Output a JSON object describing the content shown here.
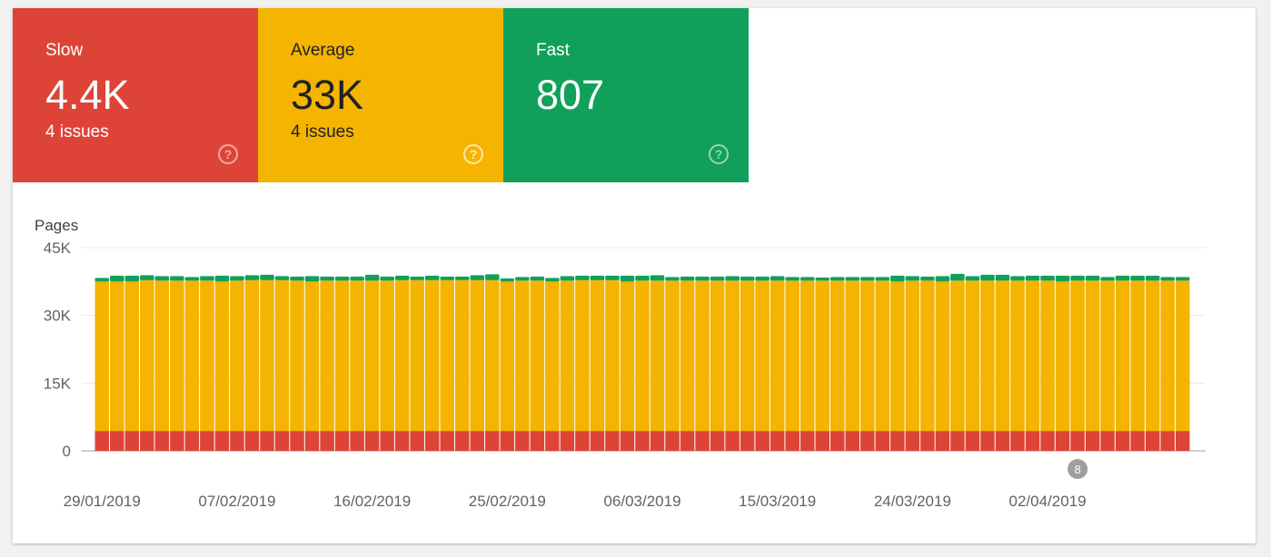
{
  "tiles": {
    "slow": {
      "label": "Slow",
      "value": "4.4K",
      "issues": "4 issues",
      "color": "#dd4437"
    },
    "average": {
      "label": "Average",
      "value": "33K",
      "issues": "4 issues",
      "color": "#f4b400"
    },
    "fast": {
      "label": "Fast",
      "value": "807",
      "issues": "",
      "color": "#11a05a"
    }
  },
  "help_icon": "question-circle-icon",
  "annotation": {
    "label": "8",
    "date": "04/04/2019",
    "color": "#9e9e9e"
  },
  "chart_data": {
    "type": "bar",
    "stacked": true,
    "ylabel": "Pages",
    "xlabel": "",
    "ylim": [
      0,
      45000
    ],
    "yticks": [
      0,
      15000,
      30000,
      45000
    ],
    "ytick_labels": [
      "0",
      "15K",
      "30K",
      "45K"
    ],
    "x_tick_labels": [
      {
        "label": "29/01/2019",
        "index": 0
      },
      {
        "label": "07/02/2019",
        "index": 9
      },
      {
        "label": "16/02/2019",
        "index": 18
      },
      {
        "label": "25/02/2019",
        "index": 27
      },
      {
        "label": "06/03/2019",
        "index": 36
      },
      {
        "label": "15/03/2019",
        "index": 45
      },
      {
        "label": "24/03/2019",
        "index": 54
      },
      {
        "label": "02/04/2019",
        "index": 63
      }
    ],
    "categories": [
      "29/01/2019",
      "30/01/2019",
      "31/01/2019",
      "01/02/2019",
      "02/02/2019",
      "03/02/2019",
      "04/02/2019",
      "05/02/2019",
      "06/02/2019",
      "07/02/2019",
      "08/02/2019",
      "09/02/2019",
      "10/02/2019",
      "11/02/2019",
      "12/02/2019",
      "13/02/2019",
      "14/02/2019",
      "15/02/2019",
      "16/02/2019",
      "17/02/2019",
      "18/02/2019",
      "19/02/2019",
      "20/02/2019",
      "21/02/2019",
      "22/02/2019",
      "23/02/2019",
      "24/02/2019",
      "25/02/2019",
      "26/02/2019",
      "27/02/2019",
      "28/02/2019",
      "01/03/2019",
      "02/03/2019",
      "03/03/2019",
      "04/03/2019",
      "05/03/2019",
      "06/03/2019",
      "07/03/2019",
      "08/03/2019",
      "09/03/2019",
      "10/03/2019",
      "11/03/2019",
      "12/03/2019",
      "13/03/2019",
      "14/03/2019",
      "15/03/2019",
      "16/03/2019",
      "17/03/2019",
      "18/03/2019",
      "19/03/2019",
      "20/03/2019",
      "21/03/2019",
      "22/03/2019",
      "23/03/2019",
      "24/03/2019",
      "25/03/2019",
      "26/03/2019",
      "27/03/2019",
      "28/03/2019",
      "29/03/2019",
      "30/03/2019",
      "31/03/2019",
      "01/04/2019",
      "02/04/2019",
      "03/04/2019",
      "04/04/2019",
      "05/04/2019",
      "06/04/2019",
      "07/04/2019",
      "08/04/2019",
      "09/04/2019",
      "10/04/2019",
      "11/04/2019"
    ],
    "series": [
      {
        "name": "Slow",
        "color": "#dd4437",
        "values": [
          4400,
          4400,
          4400,
          4400,
          4400,
          4400,
          4400,
          4400,
          4400,
          4400,
          4400,
          4400,
          4400,
          4400,
          4400,
          4400,
          4400,
          4400,
          4400,
          4400,
          4400,
          4400,
          4400,
          4400,
          4400,
          4400,
          4400,
          4400,
          4400,
          4400,
          4400,
          4400,
          4400,
          4400,
          4400,
          4400,
          4400,
          4400,
          4400,
          4400,
          4400,
          4400,
          4400,
          4400,
          4400,
          4400,
          4400,
          4400,
          4400,
          4400,
          4400,
          4400,
          4400,
          4400,
          4400,
          4400,
          4400,
          4400,
          4400,
          4400,
          4400,
          4400,
          4400,
          4400,
          4400,
          4400,
          4400,
          4400,
          4400,
          4400,
          4400,
          4400,
          4400
        ]
      },
      {
        "name": "Average",
        "color": "#f4b400",
        "values": [
          33100,
          33100,
          33100,
          33400,
          33300,
          33300,
          33300,
          33300,
          33100,
          33300,
          33400,
          33400,
          33400,
          33300,
          33100,
          33300,
          33300,
          33300,
          33300,
          33300,
          33400,
          33400,
          33400,
          33400,
          33400,
          33400,
          33400,
          33100,
          33300,
          33300,
          33100,
          33300,
          33400,
          33400,
          33400,
          33100,
          33300,
          33300,
          33300,
          33300,
          33300,
          33300,
          33300,
          33300,
          33300,
          33300,
          33300,
          33300,
          33300,
          33300,
          33300,
          33300,
          33300,
          33100,
          33300,
          33300,
          33100,
          33300,
          33300,
          33300,
          33300,
          33300,
          33300,
          33300,
          33100,
          33300,
          33300,
          33300,
          33300,
          33300,
          33300,
          33300,
          33300
        ]
      },
      {
        "name": "Fast",
        "color": "#11a05a",
        "values": [
          800,
          1300,
          1300,
          1100,
          1000,
          1000,
          800,
          1000,
          1300,
          1000,
          1100,
          1200,
          900,
          900,
          1200,
          900,
          900,
          900,
          1300,
          900,
          1000,
          800,
          1000,
          800,
          800,
          1100,
          1300,
          700,
          800,
          900,
          800,
          1000,
          1000,
          1000,
          1000,
          1300,
          1100,
          1200,
          800,
          900,
          900,
          900,
          1000,
          900,
          900,
          1000,
          800,
          800,
          700,
          800,
          800,
          800,
          800,
          1300,
          1000,
          900,
          1200,
          1500,
          1000,
          1300,
          1300,
          1000,
          1100,
          1100,
          1300,
          1100,
          1100,
          800,
          1100,
          1100,
          1100,
          800,
          800
        ]
      }
    ],
    "grid": true,
    "legend": "none"
  }
}
